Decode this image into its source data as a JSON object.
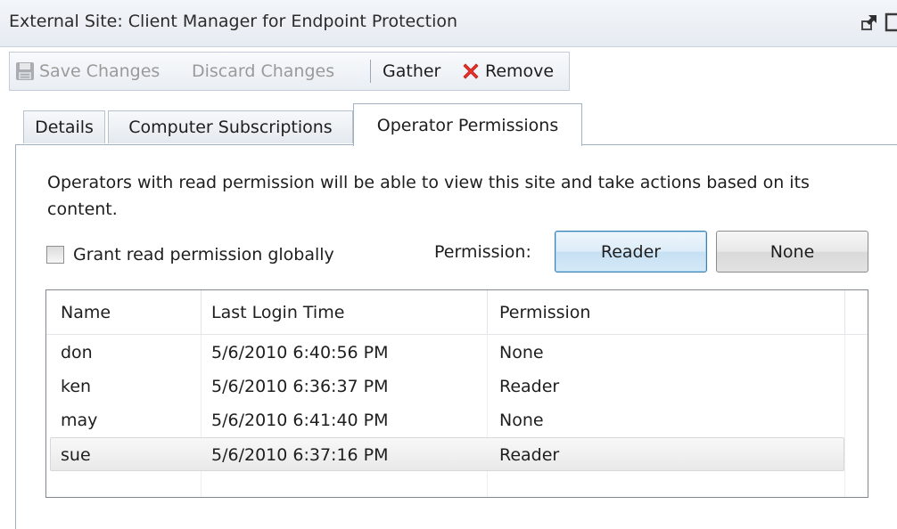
{
  "window": {
    "title": "External Site: Client Manager for Endpoint Protection",
    "icons": [
      "popout-icon",
      "restore-icon"
    ]
  },
  "toolbar": {
    "save_label": "Save Changes",
    "discard_label": "Discard Changes",
    "gather_label": "Gather",
    "remove_label": "Remove",
    "icons": [
      "floppy-disk-icon",
      "red-x-icon"
    ]
  },
  "tabs": [
    {
      "label": "Details",
      "active": false
    },
    {
      "label": "Computer Subscriptions",
      "active": false
    },
    {
      "label": "Operator Permissions",
      "active": true
    }
  ],
  "panel": {
    "description": "Operators with read permission will be able to view this site and take actions based on its content.",
    "grant_label": "Grant read permission globally",
    "grant_checked": false,
    "permission_label": "Permission:",
    "reader_button": "Reader",
    "none_button": "None"
  },
  "table": {
    "columns": [
      "Name",
      "Last Login Time",
      "Permission"
    ],
    "rows": [
      {
        "name": "don",
        "last_login": "5/6/2010 6:40:56 PM",
        "permission": "None",
        "selected": false
      },
      {
        "name": "ken",
        "last_login": "5/6/2010 6:36:37 PM",
        "permission": "Reader",
        "selected": false
      },
      {
        "name": "may",
        "last_login": "5/6/2010 6:41:40 PM",
        "permission": "None",
        "selected": false
      },
      {
        "name": "sue",
        "last_login": "5/6/2010 6:37:16 PM",
        "permission": "Reader",
        "selected": true
      }
    ]
  },
  "colors": {
    "titlebar": "#e6ebf1",
    "tab_border": "#9fb1c3",
    "remove_icon": "#e8322b",
    "reader_button_border": "#3c7fb1"
  }
}
